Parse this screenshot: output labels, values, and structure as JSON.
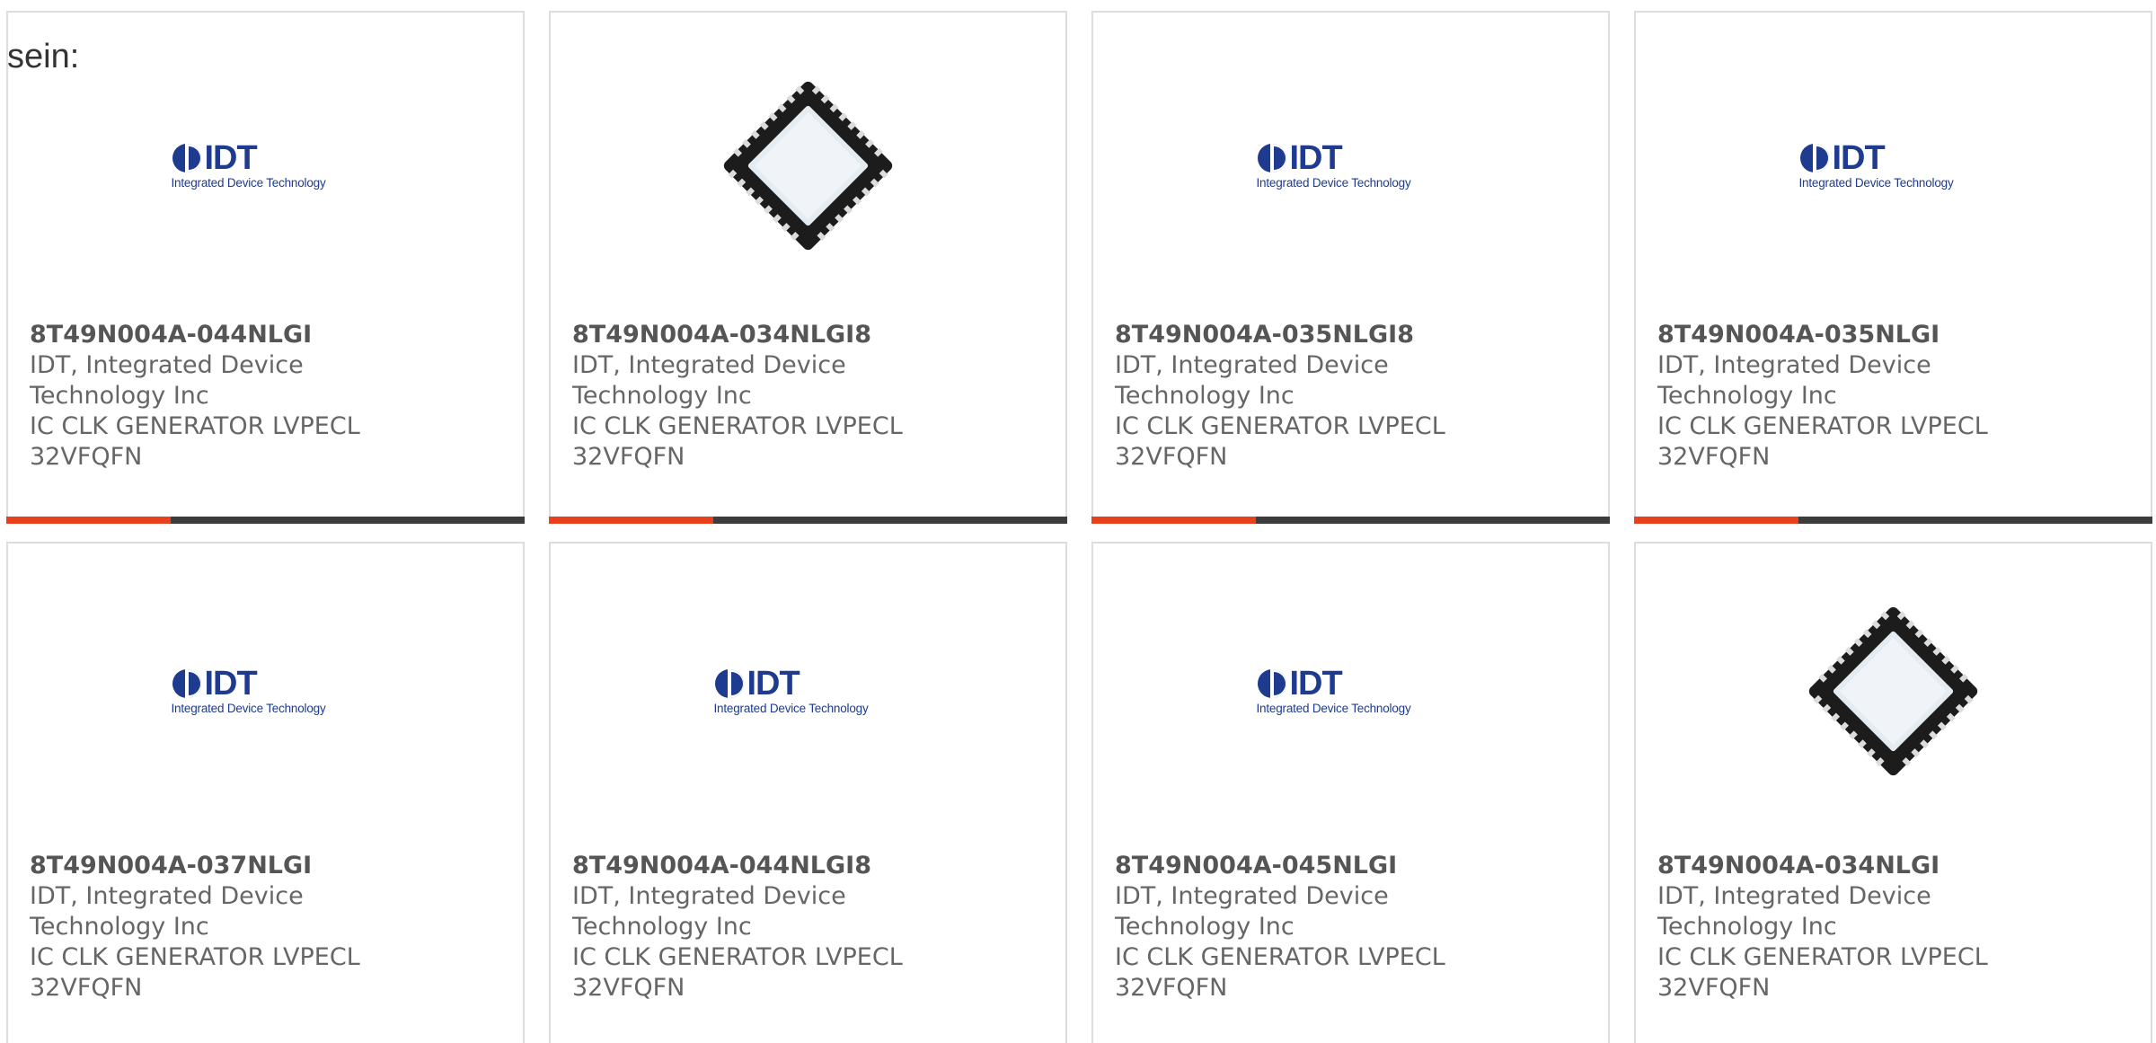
{
  "intro_text": "sein:",
  "colors": {
    "accent": "#e8401c",
    "bar": "#3c3c3c",
    "logo_blue": "#1f3b8f"
  },
  "logo": {
    "word": "IDT",
    "tagline": "Integrated Device Technology"
  },
  "products": [
    {
      "part": "8T49N004A-044NLGI",
      "mfr_line1": "IDT, Integrated Device",
      "mfr_line2": "Technology Inc",
      "desc": "IC CLK GENERATOR LVPECL",
      "package": "32VFQFN",
      "image": "idt-logo"
    },
    {
      "part": "8T49N004A-034NLGI8",
      "mfr_line1": "IDT, Integrated Device",
      "mfr_line2": "Technology Inc",
      "desc": "IC CLK GENERATOR LVPECL",
      "package": "32VFQFN",
      "image": "qfn-chip"
    },
    {
      "part": "8T49N004A-035NLGI8",
      "mfr_line1": "IDT, Integrated Device",
      "mfr_line2": "Technology Inc",
      "desc": "IC CLK GENERATOR LVPECL",
      "package": "32VFQFN",
      "image": "idt-logo"
    },
    {
      "part": "8T49N004A-035NLGI",
      "mfr_line1": "IDT, Integrated Device",
      "mfr_line2": "Technology Inc",
      "desc": "IC CLK GENERATOR LVPECL",
      "package": "32VFQFN",
      "image": "idt-logo"
    },
    {
      "part": "8T49N004A-037NLGI",
      "mfr_line1": "IDT, Integrated Device",
      "mfr_line2": "Technology Inc",
      "desc": "IC CLK GENERATOR LVPECL",
      "package": "32VFQFN",
      "image": "idt-logo"
    },
    {
      "part": "8T49N004A-044NLGI8",
      "mfr_line1": "IDT, Integrated Device",
      "mfr_line2": "Technology Inc",
      "desc": "IC CLK GENERATOR LVPECL",
      "package": "32VFQFN",
      "image": "idt-logo"
    },
    {
      "part": "8T49N004A-045NLGI",
      "mfr_line1": "IDT, Integrated Device",
      "mfr_line2": "Technology Inc",
      "desc": "IC CLK GENERATOR LVPECL",
      "package": "32VFQFN",
      "image": "idt-logo"
    },
    {
      "part": "8T49N004A-034NLGI",
      "mfr_line1": "IDT, Integrated Device",
      "mfr_line2": "Technology Inc",
      "desc": "IC CLK GENERATOR LVPECL",
      "package": "32VFQFN",
      "image": "qfn-chip"
    }
  ]
}
